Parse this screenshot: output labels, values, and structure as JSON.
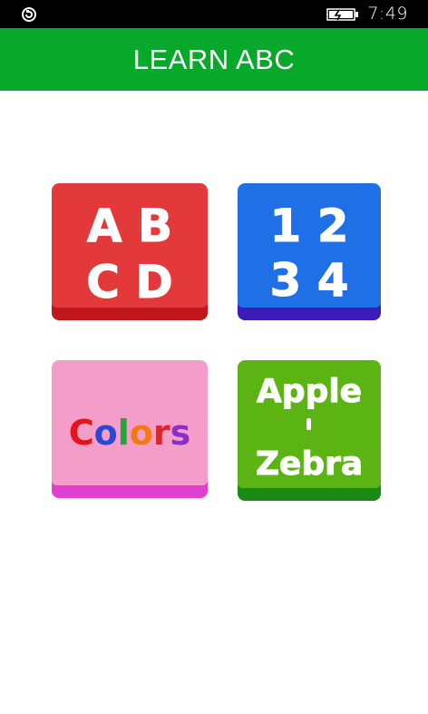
{
  "status_bar": {
    "time": "7:49",
    "icons": [
      "sync-icon",
      "battery-charging-icon"
    ]
  },
  "header": {
    "title": "LEARN ABC",
    "color": "#08a82a"
  },
  "tiles": [
    {
      "id": "abcd",
      "rows": [
        "A B",
        "C D"
      ],
      "face": "#e4393b",
      "lip": "#c0161b"
    },
    {
      "id": "numbers",
      "rows": [
        "1 2",
        "3 4"
      ],
      "face": "#1f6fe6",
      "lip": "#3c1bb8"
    },
    {
      "id": "colors",
      "letters": [
        "C",
        "o",
        "l",
        "o",
        "r",
        "s"
      ],
      "letter_colors": [
        "#e5141b",
        "#2a47d6",
        "#1fa83a",
        "#f07a14",
        "#d8282f",
        "#8b2fc9"
      ],
      "face": "#f59dc9",
      "lip": "#e03fd0"
    },
    {
      "id": "apple-zebra",
      "rows": [
        "Apple",
        "Zebra"
      ],
      "face": "#5cb414",
      "lip": "#1a8a14"
    }
  ]
}
